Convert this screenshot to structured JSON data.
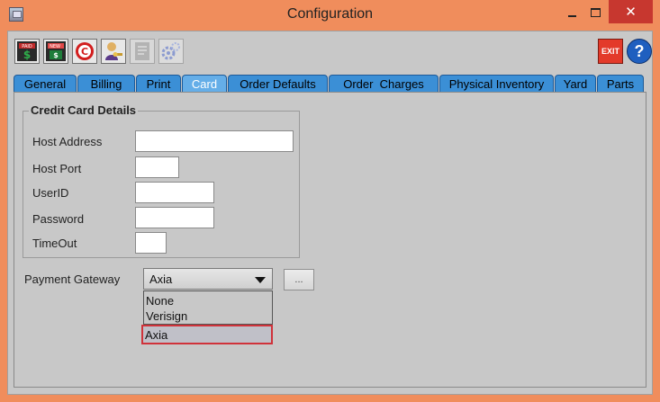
{
  "window": {
    "title": "Configuration",
    "close_glyph": "✕",
    "app_icon": "app-window-icon"
  },
  "toolbar": {
    "buttons": [
      {
        "name": "paid-dollar-icon",
        "color": "#c02a2a"
      },
      {
        "name": "new-invoice-icon",
        "color": "#1e7d3a"
      },
      {
        "name": "copyright-c-icon",
        "color": "#d21e1e"
      },
      {
        "name": "user-key-icon",
        "color": "#c79a2e"
      },
      {
        "name": "disabled-document-icon",
        "color": "#9a9a9a"
      },
      {
        "name": "settings-gear-icon",
        "color": "#8c9bd0"
      }
    ],
    "exit_label": "EXIT",
    "help_glyph": "?"
  },
  "tabs": [
    {
      "label": "General",
      "active": false
    },
    {
      "label": "Billing",
      "active": false
    },
    {
      "label": "Print",
      "active": false
    },
    {
      "label": "Card",
      "active": true
    },
    {
      "label": "Order Defaults",
      "active": false
    },
    {
      "label": "Order  Charges",
      "active": false
    },
    {
      "label": "Physical Inventory",
      "active": false
    },
    {
      "label": "Yard",
      "active": false
    },
    {
      "label": "Parts",
      "active": false
    }
  ],
  "credit_card": {
    "group_title": "Credit Card Details",
    "host_address_label": "Host Address",
    "host_address_value": "",
    "host_port_label": "Host Port",
    "host_port_value": "",
    "userid_label": "UserID",
    "userid_value": "",
    "password_label": "Password",
    "password_value": "",
    "timeout_label": "TimeOut",
    "timeout_value": ""
  },
  "payment_gateway": {
    "label": "Payment Gateway",
    "selected": "Axia",
    "more_button": "...",
    "options": [
      "None",
      "Verisign",
      "Axia"
    ]
  },
  "colors": {
    "window_frame": "#f08d5c",
    "tab_bg": "#3b8fd6",
    "tab_active_bg": "#65aee8",
    "highlight_border": "#d0323a"
  }
}
